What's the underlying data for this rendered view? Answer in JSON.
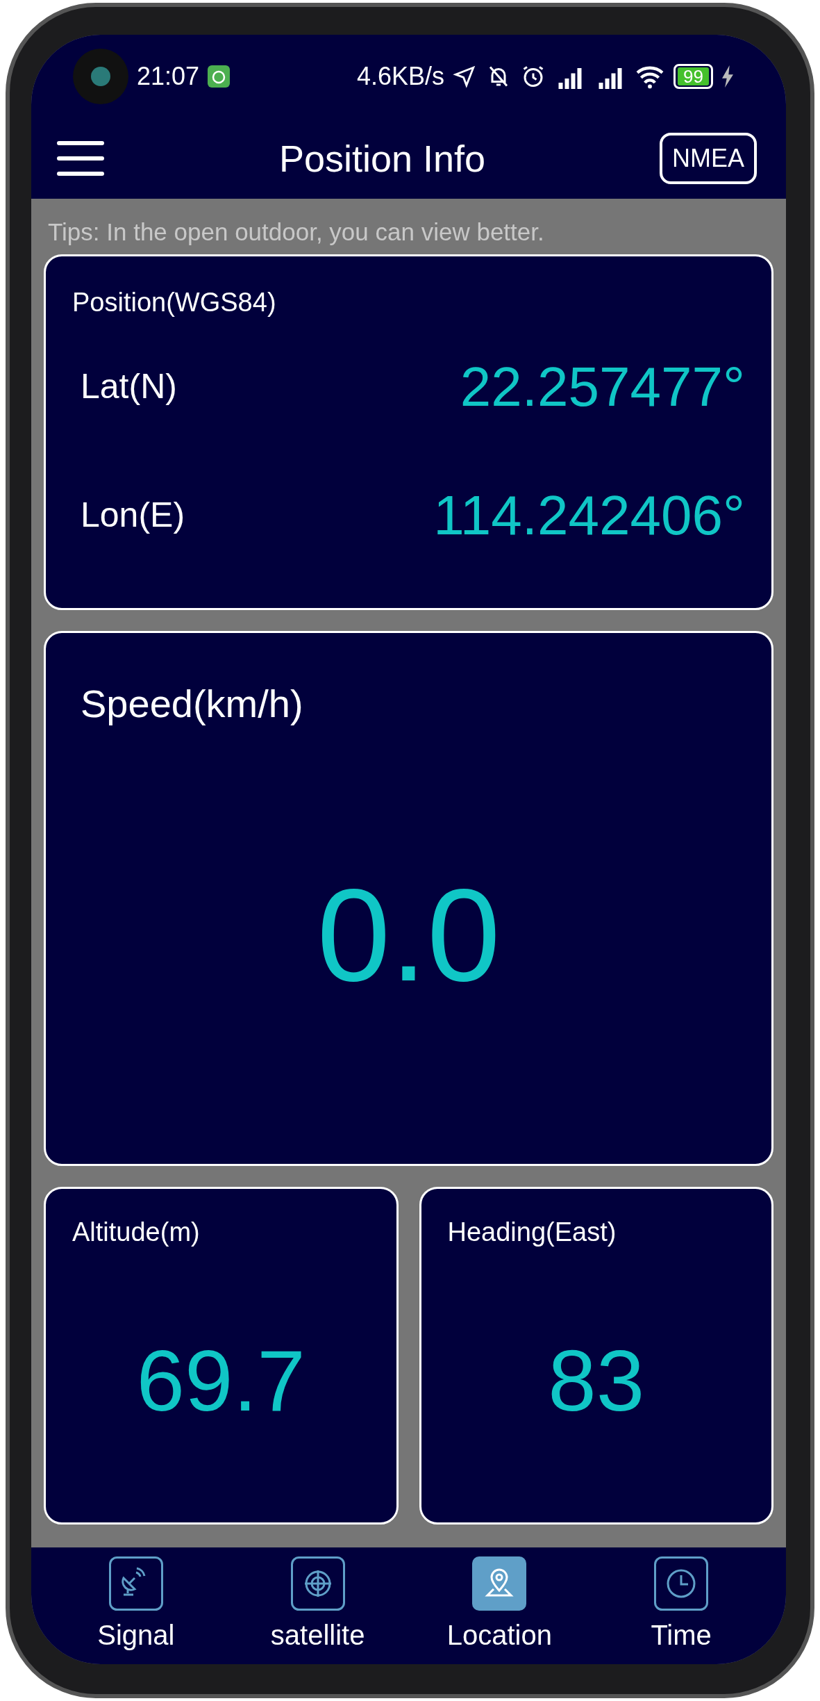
{
  "status_bar": {
    "time": "21:07",
    "net_speed": "4.6KB/s",
    "battery": "99"
  },
  "header": {
    "title": "Position Info",
    "action": "NMEA"
  },
  "tips": "Tips: In the open outdoor, you can view better.",
  "position": {
    "title": "Position(WGS84)",
    "rows": [
      {
        "label": "Lat(N)",
        "value": "22.257477°"
      },
      {
        "label": "Lon(E)",
        "value": "114.242406°"
      }
    ]
  },
  "speed": {
    "title": "Speed(km/h)",
    "value": "0.0"
  },
  "small_cards": [
    {
      "title": "Altitude(m)",
      "value": "69.7"
    },
    {
      "title": "Heading(East)",
      "value": "83"
    }
  ],
  "tabs": [
    {
      "label": "Signal",
      "kind": "dish",
      "selected": false
    },
    {
      "label": "satellite",
      "kind": "globe",
      "selected": false
    },
    {
      "label": "Location",
      "kind": "pin",
      "selected": true
    },
    {
      "label": "Time",
      "kind": "clock",
      "selected": false
    }
  ]
}
